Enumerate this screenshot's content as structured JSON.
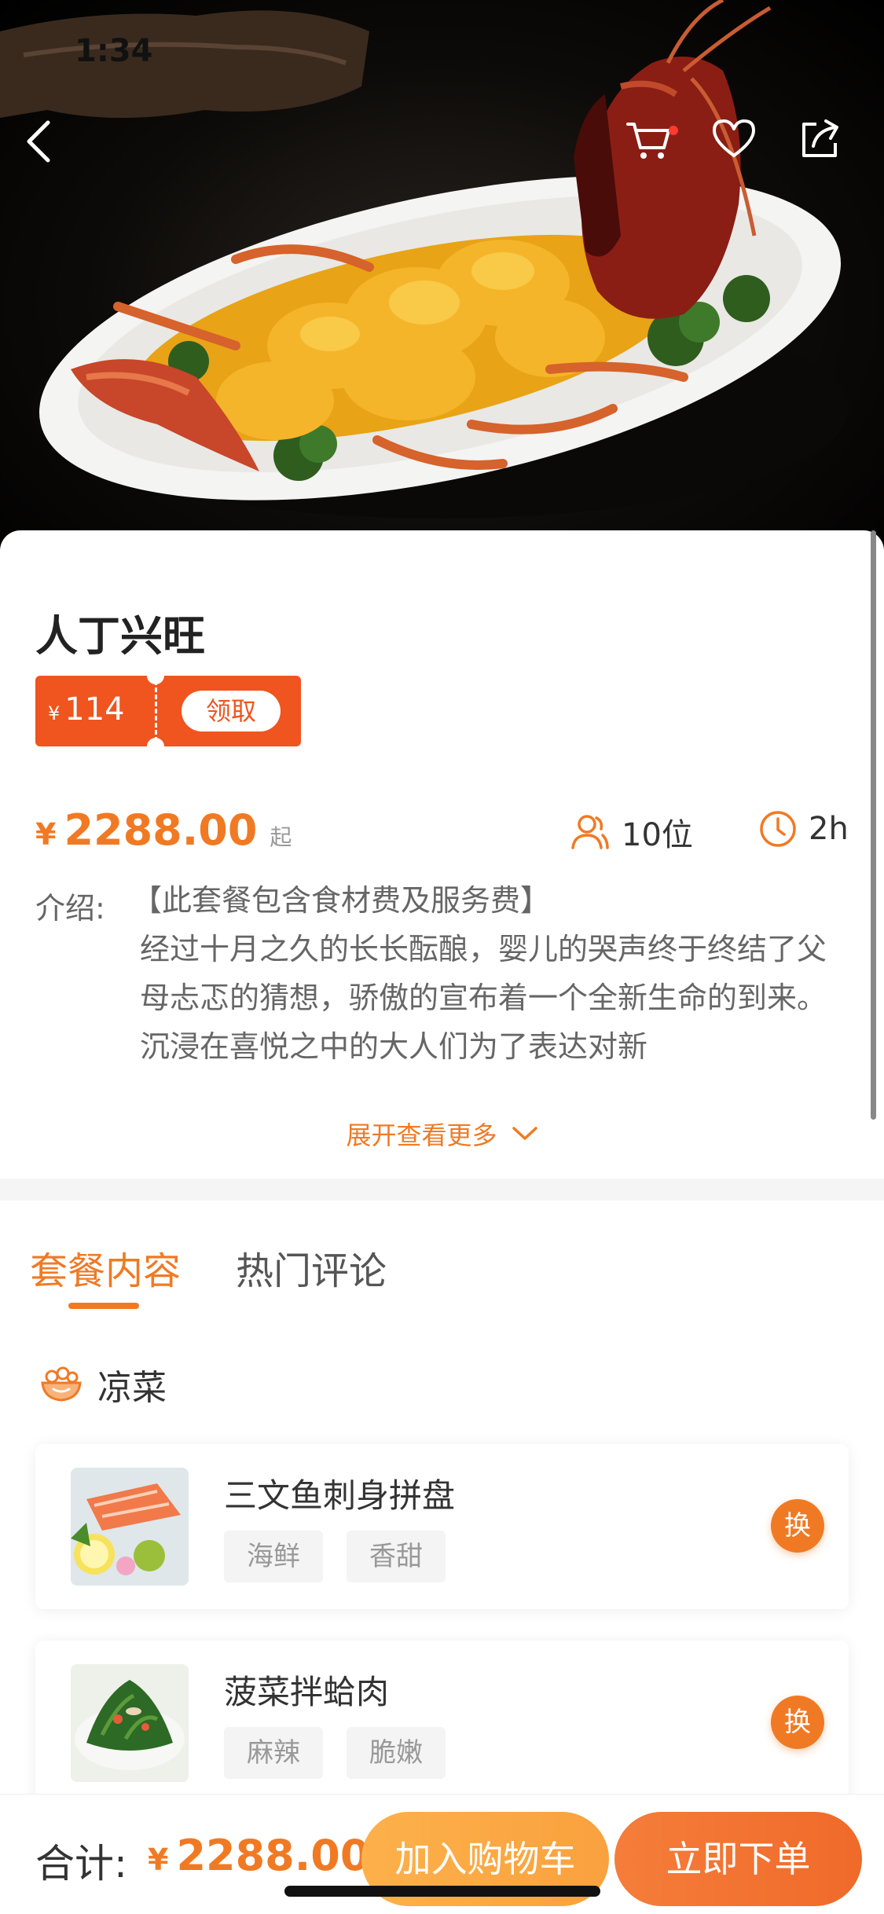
{
  "status_bar": {
    "time": "1:34"
  },
  "nav": {
    "back_icon": "chevron-left-icon",
    "cart_icon": "cart-icon",
    "favorite_icon": "heart-icon",
    "share_icon": "share-icon"
  },
  "product": {
    "title": "人丁兴旺",
    "coupon": {
      "currency": "¥",
      "amount": "114",
      "claim_label": "领取"
    },
    "price": {
      "currency": "¥",
      "value": "2288.00",
      "suffix": "起"
    },
    "guests": "10位",
    "duration": "2h",
    "intro_label": "介绍:",
    "intro_head": "【此套餐包含食材费及服务费】",
    "intro_text": "经过十月之久的长长酝酿，婴儿的哭声终于终结了父母忐忑的猜想，骄傲的宣布着一个全新生命的到来。沉浸在喜悦之中的大人们为了表达对新",
    "expand_label": "展开查看更多"
  },
  "tabs": [
    {
      "label": "套餐内容",
      "active": true
    },
    {
      "label": "热门评论",
      "active": false
    }
  ],
  "section": {
    "title": "凉菜",
    "icon": "salad-bowl-icon"
  },
  "dishes": [
    {
      "name": "三文鱼刺身拼盘",
      "tags": [
        "海鲜",
        "香甜"
      ],
      "swap_label": "换"
    },
    {
      "name": "菠菜拌蛤肉",
      "tags": [
        "麻辣",
        "脆嫩"
      ],
      "swap_label": "换"
    }
  ],
  "bottom_bar": {
    "total_label": "合计:",
    "currency": "¥",
    "total": "2288.00",
    "add_to_cart": "加入购物车",
    "order_now": "立即下单"
  },
  "colors": {
    "accent": "#f07a24",
    "coupon": "#f0541f",
    "cart_button": "#fdb14a",
    "order_button": "#f57d3a"
  }
}
